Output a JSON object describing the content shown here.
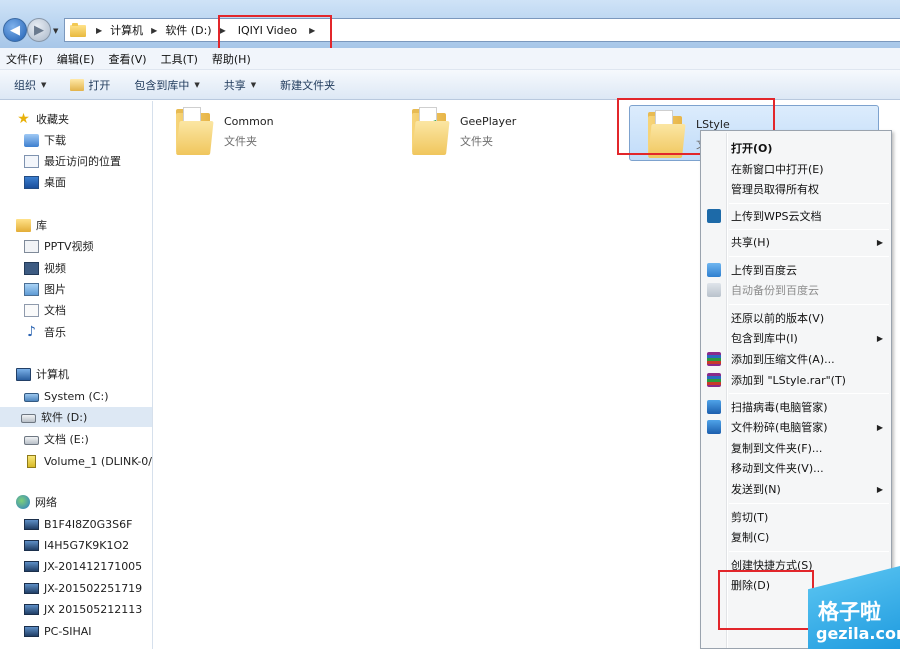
{
  "address": {
    "crumbs": [
      "计算机",
      "软件 (D:)",
      "IQIYI Video"
    ]
  },
  "menubar": [
    "文件(F)",
    "编辑(E)",
    "查看(V)",
    "工具(T)",
    "帮助(H)"
  ],
  "toolbar": {
    "organize": "组织",
    "open": "打开",
    "include_library": "包含到库中",
    "share": "共享",
    "new_folder": "新建文件夹"
  },
  "sidebar": {
    "favorites": "收藏夹",
    "downloads": "下载",
    "recent": "最近访问的位置",
    "desktop": "桌面",
    "library": "库",
    "pptv": "PPTV视频",
    "videos": "视频",
    "pictures": "图片",
    "documents": "文档",
    "music": "音乐",
    "computer": "计算机",
    "drive_c": "System (C:)",
    "drive_d": "软件 (D:)",
    "drive_e": "文档 (E:)",
    "volume": "Volume_1 (DLINK-0/",
    "network": "网络",
    "pc1": "B1F4I8Z0G3S6F",
    "pc2": "I4H5G7K9K1O2",
    "pc3": "JX-201412171005",
    "pc4": "JX-201502251719",
    "pc5": "JX 201505212113",
    "pc6": "PC-SIHAI"
  },
  "folders": [
    {
      "name": "Common",
      "type": "文件夹"
    },
    {
      "name": "GeePlayer",
      "type": "文件夹"
    },
    {
      "name": "LStyle",
      "type": "文件夹"
    }
  ],
  "context_menu": {
    "open": "打开(O)",
    "open_new_window": "在新窗口中打开(E)",
    "take_ownership": "管理员取得所有权",
    "upload_wps": "上传到WPS云文档",
    "share": "共享(H)",
    "upload_baidu": "上传到百度云",
    "auto_backup_baidu": "自动备份到百度云",
    "restore_versions": "还原以前的版本(V)",
    "include_library": "包含到库中(I)",
    "add_archive": "添加到压缩文件(A)...",
    "add_rar": "添加到 \"LStyle.rar\"(T)",
    "scan_virus": "扫描病毒(电脑管家)",
    "shred": "文件粉碎(电脑管家)",
    "copy_to_folder": "复制到文件夹(F)...",
    "move_to_folder": "移动到文件夹(V)...",
    "send_to": "发送到(N)",
    "cut": "剪切(T)",
    "copy": "复制(C)",
    "create_shortcut": "创建快捷方式(S)",
    "delete": "删除(D)"
  },
  "watermark": {
    "line1": "格子啦",
    "line2": "gezila.com"
  },
  "colors": {
    "highlight_box": "#e2262b",
    "selection": "#c1dcf9",
    "watermark": "#1f9bdf"
  }
}
